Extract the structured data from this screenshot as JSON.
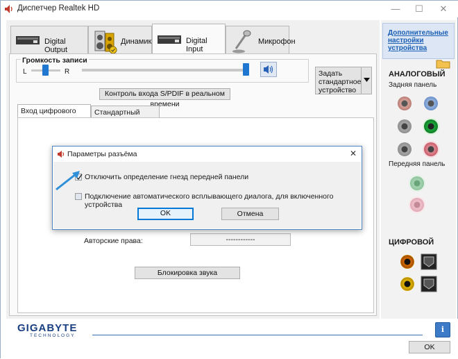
{
  "window": {
    "title": "Диспетчер Realtek HD",
    "controls": [
      "—",
      "☐",
      "✕"
    ]
  },
  "tabs": [
    {
      "label": "Digital Output",
      "icon": "digital-output-device-icon"
    },
    {
      "label": "Динамики",
      "icon": "speakers-icon"
    },
    {
      "label": "Digital Input",
      "icon": "digital-input-device-icon",
      "active": true
    },
    {
      "label": "Микрофон",
      "icon": "microphone-icon"
    }
  ],
  "recording": {
    "volume_label": "Громкость записи",
    "left_label": "L",
    "right_label": "R",
    "balance_level": 0.5,
    "volume_level": 1.0
  },
  "default_device_button": "Задать стандартное устройство",
  "spdif_monitor_button": "Контроль входа S/PDIF в реальном времени",
  "subtabs": [
    "Вход цифрового звука",
    "Стандартный формат"
  ],
  "copyright": {
    "label": "Авторские права:",
    "value": "------------"
  },
  "lock_sound_button": "Блокировка звука",
  "right_panel": {
    "advanced_settings_link": "Дополнительные настройки устройства",
    "analog_heading": "АНАЛОГОВЫЙ",
    "rear_panel_label": "Задняя панель",
    "front_panel_label": "Передняя панель",
    "digital_heading": "ЦИФРОВОЙ",
    "colors": {
      "link": "#1a5fb4",
      "panel_bg": "#f2f2f2",
      "header_bg": "#dce6f4"
    }
  },
  "dialog": {
    "title": "Параметры разъёма",
    "close_glyph": "✕",
    "option1": {
      "label": "Отключить определение гнезд передней панели",
      "checked": true
    },
    "option2": {
      "label": "Подключение автоматического всплывающего диалога, для включенного устройства",
      "checked": false
    },
    "ok_button": "OK",
    "cancel_button": "Отмена"
  },
  "branding": {
    "logo": "GIGABYTE",
    "logo_sub": "TECHNOLOGY"
  },
  "footer": {
    "ok_button": "OK",
    "info_glyph": "i"
  }
}
